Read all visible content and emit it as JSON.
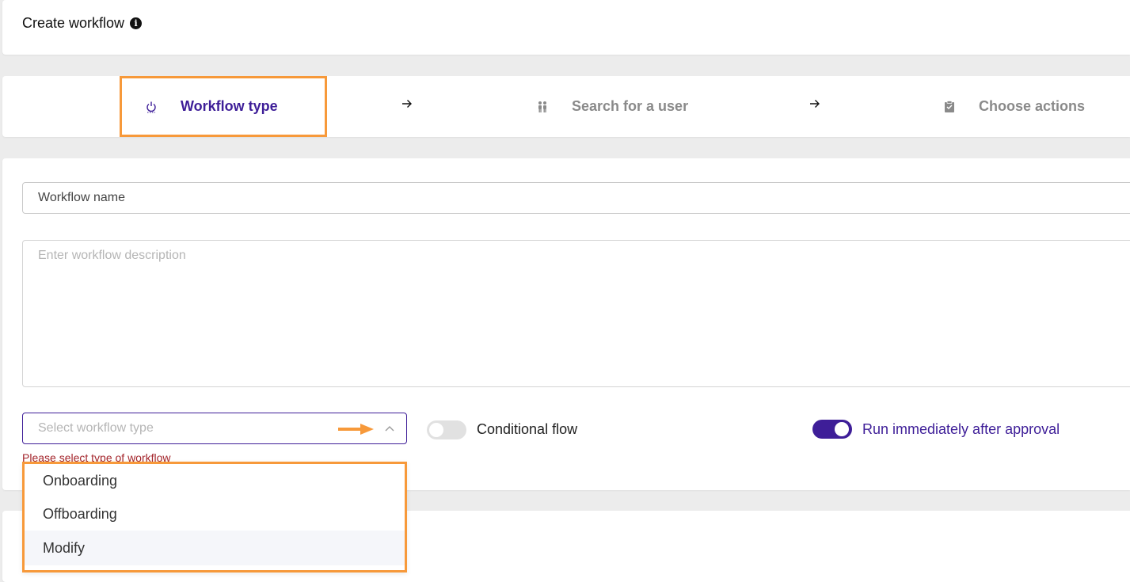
{
  "header": {
    "title": "Create workflow",
    "info_icon": "info-icon"
  },
  "stepper": {
    "steps": [
      {
        "label": "Workflow type",
        "icon": "power-icon",
        "active": true
      },
      {
        "label": "Search for a user",
        "icon": "users-icon",
        "active": false
      },
      {
        "label": "Choose actions",
        "icon": "clipboard-icon",
        "active": false
      }
    ],
    "separator_icon": "arrow-right-icon"
  },
  "form": {
    "name_placeholder": "Workflow name",
    "description_placeholder": "Enter workflow description",
    "type_select": {
      "placeholder": "Select workflow type",
      "expanded": true,
      "options": [
        "Onboarding",
        "Offboarding",
        "Modify"
      ],
      "hovered_option": "Modify"
    },
    "validation_message": "Please select type of workflow",
    "conditional_flow": {
      "label": "Conditional flow",
      "on": false
    },
    "run_immediately": {
      "label": "Run immediately after approval",
      "on": true
    }
  },
  "colors": {
    "accent": "#3e1e98",
    "highlight_annotation": "#f7993a",
    "error": "#a4262c",
    "muted_text": "#8a8a8a"
  }
}
